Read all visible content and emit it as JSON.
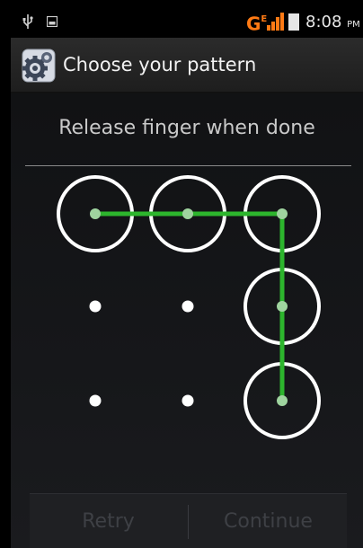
{
  "status_bar": {
    "network_label": "G",
    "network_sup": "E",
    "time": "8:08",
    "ampm": "PM"
  },
  "action_bar": {
    "title": "Choose your pattern",
    "icon": "settings-gear-icon"
  },
  "pattern": {
    "header": "Release finger when done",
    "selected_dots": [
      1,
      2,
      3,
      6,
      9
    ],
    "line_color": "#2db52d",
    "ring_color": "#ffffff"
  },
  "buttons": {
    "retry_label": "Retry",
    "continue_label": "Continue"
  }
}
